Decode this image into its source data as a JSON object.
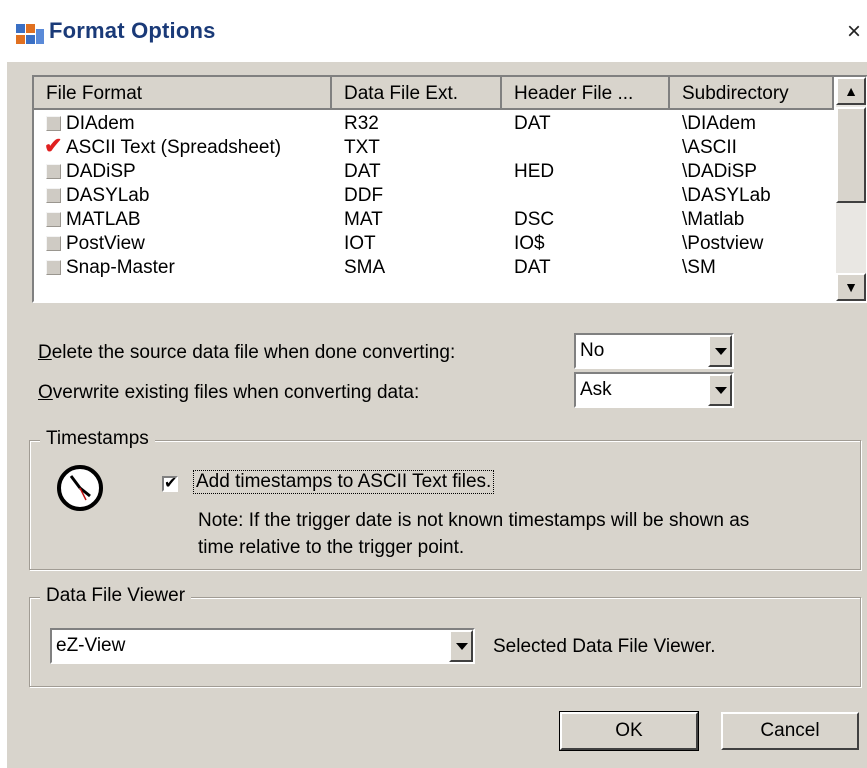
{
  "window": {
    "title": "Format Options",
    "close_glyph": "×"
  },
  "file_list": {
    "columns": [
      "File Format",
      "Data File Ext.",
      "Header File ...",
      "Subdirectory"
    ],
    "rows": [
      {
        "checked": false,
        "format": "DIAdem",
        "ext": "R32",
        "header": "DAT",
        "subdir": "\\DIAdem"
      },
      {
        "checked": true,
        "format": "ASCII Text (Spreadsheet)",
        "ext": "TXT",
        "header": "",
        "subdir": "\\ASCII"
      },
      {
        "checked": false,
        "format": "DADiSP",
        "ext": "DAT",
        "header": "HED",
        "subdir": "\\DADiSP"
      },
      {
        "checked": false,
        "format": "DASYLab",
        "ext": "DDF",
        "header": "",
        "subdir": "\\DASYLab"
      },
      {
        "checked": false,
        "format": "MATLAB",
        "ext": "MAT",
        "header": "DSC",
        "subdir": "\\Matlab"
      },
      {
        "checked": false,
        "format": "PostView",
        "ext": "IOT",
        "header": "IO$",
        "subdir": "\\Postview"
      },
      {
        "checked": false,
        "format": "Snap-Master",
        "ext": "SMA",
        "header": "DAT",
        "subdir": "\\SM"
      }
    ]
  },
  "options": {
    "delete_label_hotkey": "D",
    "delete_label_rest": "elete the source data file when done converting:",
    "delete_value": "No",
    "overwrite_label_hotkey": "O",
    "overwrite_label_rest": "verwrite existing files when converting data:",
    "overwrite_value": "Ask"
  },
  "timestamps": {
    "group_title": "Timestamps",
    "checkbox_checked": true,
    "checkbox_label": "Add timestamps to ASCII Text files.",
    "note_line1": "Note: If the trigger date is not known timestamps will be shown as",
    "note_line2": "time relative to the trigger point."
  },
  "viewer": {
    "group_title": "Data File Viewer",
    "value": "eZ-View",
    "description": "Selected Data File Viewer."
  },
  "buttons": {
    "ok": "OK",
    "cancel": "Cancel"
  },
  "icons": {
    "app": "format-options-app-icon",
    "clock": "clock-icon",
    "close": "close-icon"
  }
}
